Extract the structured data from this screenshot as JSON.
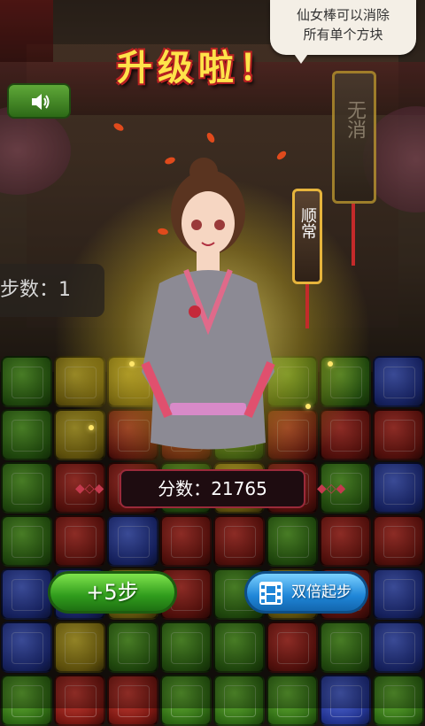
{
  "banner": {
    "level_up": "升级啦！"
  },
  "tooltip": {
    "line1": "仙女棒可以消除",
    "line2": "所有单个方块"
  },
  "hud": {
    "steps_text": "步数：1"
  },
  "tags": {
    "disabled": "无消",
    "active": "顺常"
  },
  "score": {
    "label": "分数：",
    "value": "21765"
  },
  "buttons": {
    "plus_steps": "+5步",
    "double_start": "双倍起步"
  },
  "icons": {
    "sound": "speaker-icon",
    "video": "film-icon"
  },
  "colors": {
    "title": "#ffe34a",
    "green_button": "#2f9b1c",
    "blue_button": "#1f86d8",
    "score_border": "#9a2a3a"
  }
}
